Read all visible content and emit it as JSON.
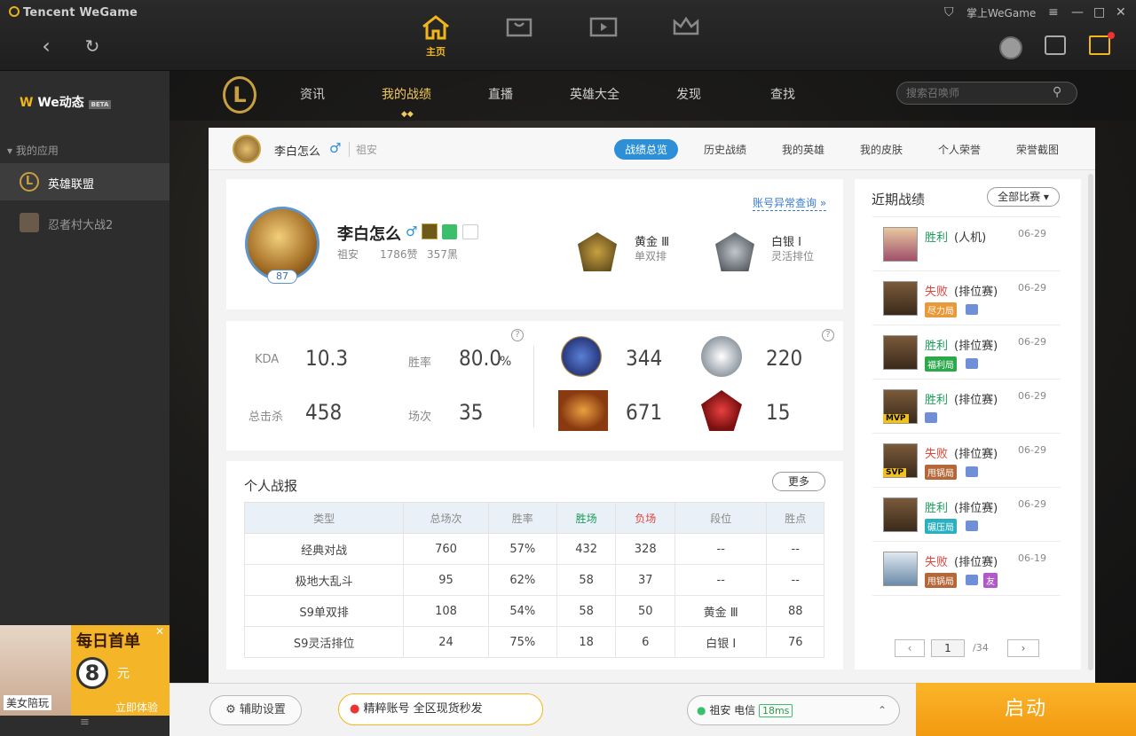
{
  "titlebar": {
    "brand": "Tencent WeGame",
    "home_label": "主页",
    "mobile_label": "掌上WeGame"
  },
  "sidebar": {
    "logo": "We动态",
    "beta": "BETA",
    "section": "我的应用",
    "apps": [
      {
        "label": "英雄联盟"
      },
      {
        "label": "忍者村大战2"
      }
    ],
    "ad": {
      "title": "每日首单",
      "price": "8",
      "unit": "元",
      "caption": "美女陪玩",
      "cta": "立即体验"
    }
  },
  "gamenav": {
    "items": [
      "资讯",
      "我的战绩",
      "直播",
      "英雄大全",
      "发现",
      "查找"
    ],
    "active": "我的战绩",
    "search_placeholder": "搜索召唤师"
  },
  "subbar": {
    "name": "李白怎么",
    "gender": "♂",
    "server": "祖安",
    "tabs": [
      "战绩总览",
      "历史战绩",
      "我的英雄",
      "我的皮肤",
      "个人荣誉",
      "荣誉截图"
    ]
  },
  "profile": {
    "name": "李白怎么",
    "server": "祖安",
    "likes": "1786赞",
    "black": "357黑",
    "level": "87",
    "abnormal_link": "账号异常查询 »",
    "ranks": [
      {
        "tier": "黄金 Ⅲ",
        "queue": "单双排"
      },
      {
        "tier": "白银 Ⅰ",
        "queue": "灵活排位"
      }
    ]
  },
  "stats": {
    "kda_label": "KDA",
    "kda": "10.3",
    "winrate_label": "胜率",
    "winrate": "80.0",
    "winrate_unit": "%",
    "kills_label": "总击杀",
    "kills": "458",
    "games_label": "场次",
    "games": "35",
    "badges": [
      {
        "name": "MVP",
        "count": "344"
      },
      {
        "name": "SVP",
        "count": "220"
      },
      {
        "name": "LEGENDARY",
        "count": "671"
      },
      {
        "name": "5",
        "count": "15"
      }
    ]
  },
  "report": {
    "title": "个人战报",
    "more": "更多",
    "headers": [
      "类型",
      "总场次",
      "胜率",
      "胜场",
      "负场",
      "段位",
      "胜点"
    ],
    "rows": [
      [
        "经典对战",
        "760",
        "57%",
        "432",
        "328",
        "--",
        "--"
      ],
      [
        "极地大乱斗",
        "95",
        "62%",
        "58",
        "37",
        "--",
        "--"
      ],
      [
        "S9单双排",
        "108",
        "54%",
        "58",
        "50",
        "黄金 Ⅲ",
        "88"
      ],
      [
        "S9灵活排位",
        "24",
        "75%",
        "18",
        "6",
        "白银 Ⅰ",
        "76"
      ]
    ]
  },
  "recent": {
    "title": "近期战绩",
    "filter": "全部比赛",
    "items": [
      {
        "result": "胜利",
        "mode": "(人机)",
        "date": "06-29",
        "tag": "",
        "win": true
      },
      {
        "result": "失败",
        "mode": "(排位赛)",
        "date": "06-29",
        "tag": "尽力局",
        "win": false
      },
      {
        "result": "胜利",
        "mode": "(排位赛)",
        "date": "06-29",
        "tag": "福利局",
        "win": true
      },
      {
        "result": "胜利",
        "mode": "(排位赛)",
        "date": "06-29",
        "tag": "",
        "win": true
      },
      {
        "result": "失败",
        "mode": "(排位赛)",
        "date": "06-29",
        "tag": "甩锅局",
        "win": false
      },
      {
        "result": "胜利",
        "mode": "(排位赛)",
        "date": "06-29",
        "tag": "碾压局",
        "win": true
      },
      {
        "result": "失败",
        "mode": "(排位赛)",
        "date": "06-19",
        "tag": "甩锅局",
        "win": false
      }
    ],
    "friend_tag": "友",
    "mvp_badge": "MVP",
    "svp_badge": "SVP",
    "page": "1",
    "total": "/34"
  },
  "footer": {
    "assist": "辅助设置",
    "promo": "精粹账号 全区现货秒发",
    "server": "祖安 电信",
    "ping": "18ms",
    "launch": "启动"
  },
  "colors": {
    "accent": "#f2b61a",
    "win": "#1a9a5a",
    "lose": "#e0463c",
    "tab": "#2d8fd5"
  }
}
